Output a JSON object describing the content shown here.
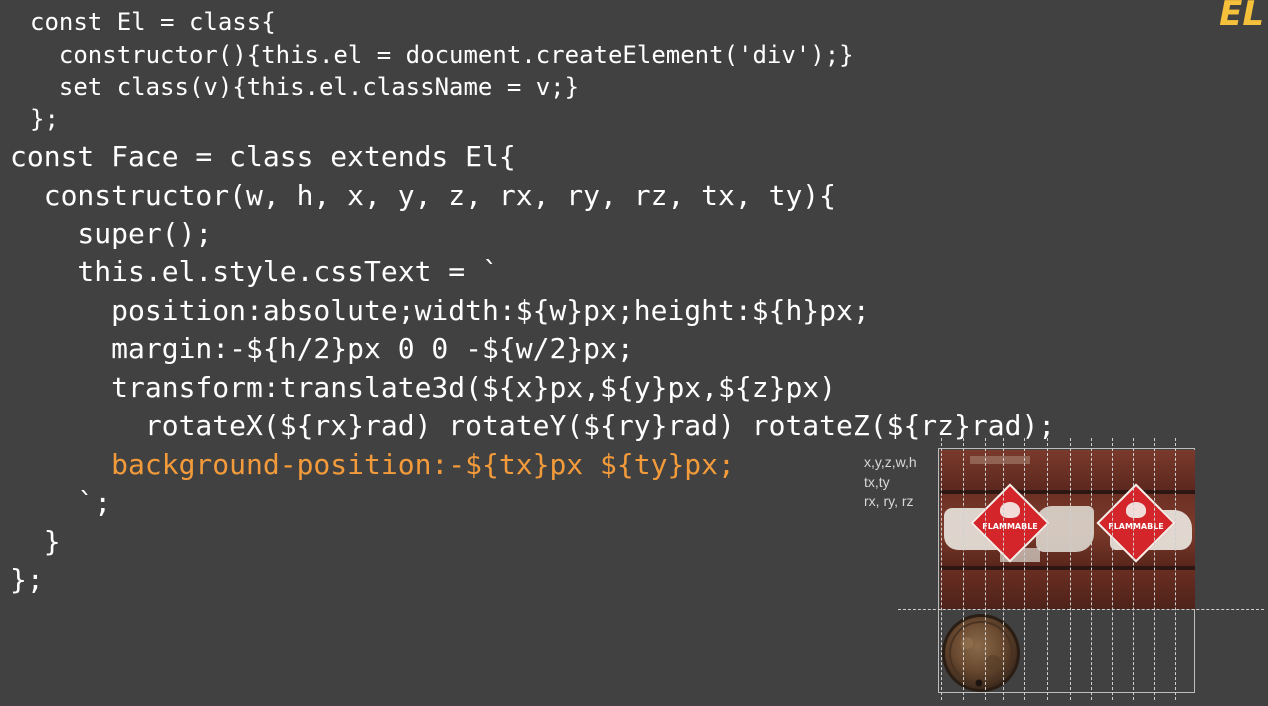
{
  "code": {
    "lines": [
      "const El = class{",
      "  constructor(){this.el = document.createElement('div');}",
      "  set class(v){this.el.className = v;}",
      "};",
      "const Face = class extends El{",
      "  constructor(w, h, x, y, z, rx, ry, rz, tx, ty){",
      "    super();",
      "    this.el.style.cssText = `",
      "      position:absolute;width:${w}px;height:${h}px;",
      "      margin:-${h/2}px 0 0 -${w/2}px;",
      "      transform:translate3d(${x}px,${y}px,${z}px)",
      "        rotateX(${rx}rad) rotateY(${ry}rad) rotateZ(${rz}rad);",
      "      background-position:-${tx}px ${ty}px;",
      "    `;",
      "  }",
      "};"
    ]
  },
  "corner_tag": "EL",
  "texture_labels": {
    "line1": "x,y,z,w,h",
    "line2": "tx,ty",
    "line3": "rx, ry, rz"
  },
  "texture": {
    "sign_text": "FLAMMABLE",
    "colors": {
      "background": "#414141",
      "code_text": "#ffffff",
      "highlight": "#f39b3a",
      "corner_tag": "#f6c13a",
      "barrel_red": "#6e3126",
      "sign_red": "#d4262a"
    }
  }
}
